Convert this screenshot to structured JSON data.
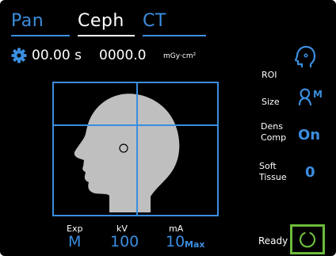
{
  "tabs": [
    {
      "label": "Pan",
      "active": false
    },
    {
      "label": "Ceph",
      "active": true
    },
    {
      "label": "CT",
      "active": false
    }
  ],
  "status": {
    "exposure_time": "00.00 s",
    "dose": "0000.0",
    "dose_unit": "mGy·cm²"
  },
  "settings": {
    "roi": {
      "label": "ROI",
      "icon": "roi-head-icon"
    },
    "size": {
      "label": "Size",
      "icon": "size-m-icon",
      "value": "M"
    },
    "dens_comp": {
      "label_line1": "Dens",
      "label_line2": "Comp",
      "value": "On"
    },
    "soft_tissue": {
      "label_line1": "Soft",
      "label_line2": "Tissue",
      "value": "0"
    }
  },
  "exposure": {
    "exp": {
      "label": "Exp",
      "value": "M"
    },
    "kv": {
      "label": "kV",
      "value": "100"
    },
    "ma": {
      "label": "mA",
      "value": "10",
      "suffix": "Max"
    }
  },
  "ready": {
    "label": "Ready",
    "icon": "ready-ring-icon"
  },
  "colors": {
    "background": "#000000",
    "accent": "#3b8ee0",
    "active_text": "#ffffff",
    "ready_border": "#6dbb3b",
    "head": "#bfbfbf"
  }
}
